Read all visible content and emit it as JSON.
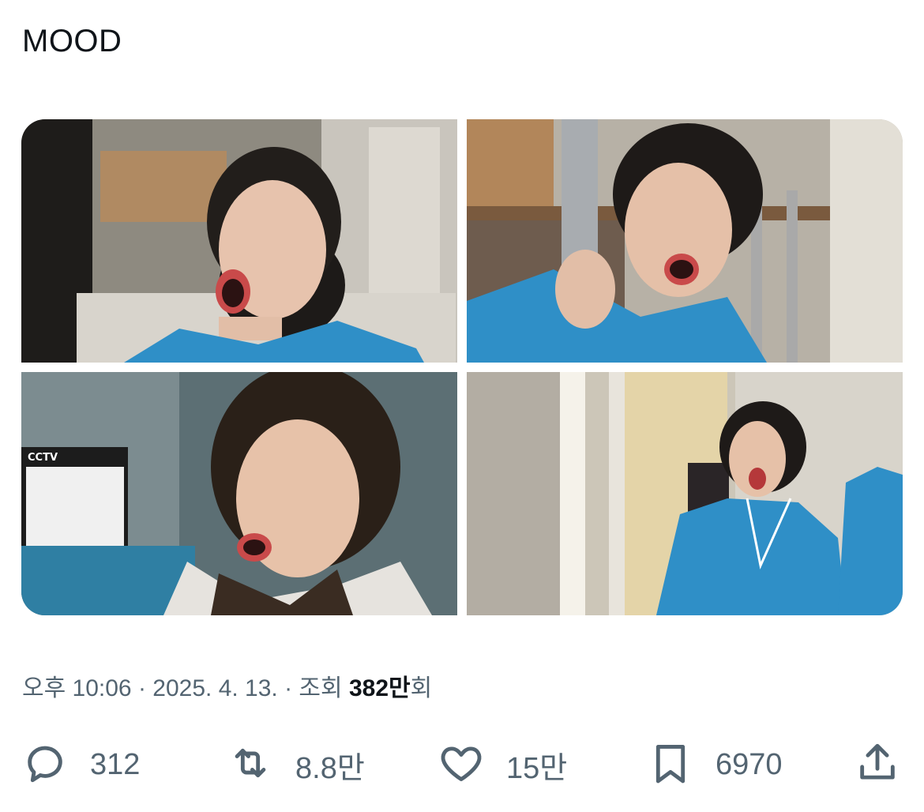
{
  "tweet": {
    "text": "MOOD",
    "media": [
      {
        "icon": "photo-yawning-nurse-lounge"
      },
      {
        "icon": "photo-yawning-nurse-bunkbed"
      },
      {
        "icon": "photo-yawning-woman-cctv-sign"
      },
      {
        "icon": "photo-yawning-nurse-hallway"
      }
    ],
    "meta": {
      "time": "오후 10:06",
      "separator": " · ",
      "date": "2025. 4. 13.",
      "views_label": "조회 ",
      "views_count": "382만",
      "views_suffix": "회"
    }
  },
  "actions": {
    "reply": {
      "icon": "reply-icon",
      "count": "312"
    },
    "retweet": {
      "icon": "retweet-icon",
      "count": "8.8만"
    },
    "like": {
      "icon": "heart-icon",
      "count": "15만"
    },
    "bookmark": {
      "icon": "bookmark-icon",
      "count": "6970"
    },
    "share": {
      "icon": "share-icon"
    }
  },
  "colors": {
    "text_primary": "#0f1419",
    "text_secondary": "#536471",
    "scrubs_blue": "#2f8fc7"
  }
}
